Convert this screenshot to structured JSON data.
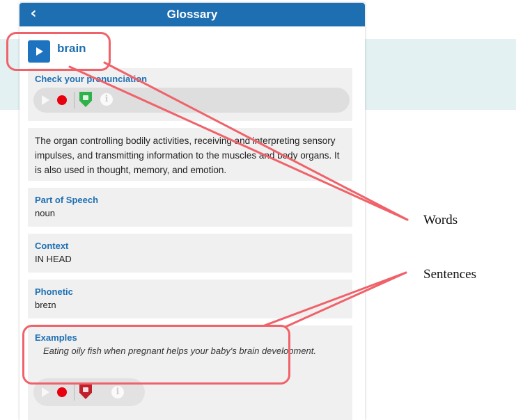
{
  "header": {
    "title": "Glossary",
    "back_icon": "chevron-left-icon"
  },
  "entry": {
    "word": "brain",
    "pronunciation_label": "Check your pronunciation",
    "definition": "The organ controlling bodily activities, receiving and interpreting sensory impulses, and transmitting information to the muscles and body organs. It is also used in thought, memory, and emotion.",
    "part_of_speech_label": "Part of Speech",
    "part_of_speech": "noun",
    "context_label": "Context",
    "context": "IN HEAD",
    "phonetic_label": "Phonetic",
    "phonetic": "breɪn",
    "examples_label": "Examples",
    "example": "Eating oily fish when pregnant helps your baby's brain development."
  },
  "annotations": {
    "words": "Words",
    "sentences": "Sentences"
  },
  "colors": {
    "header_blue": "#1e6fb2",
    "accent_blue": "#1e73c0",
    "record_red": "#e8000e",
    "shield_green": "#2fb24b",
    "shield_red": "#c0202a",
    "callout_red": "#f0626a",
    "band_teal": "#e3f1f3"
  }
}
